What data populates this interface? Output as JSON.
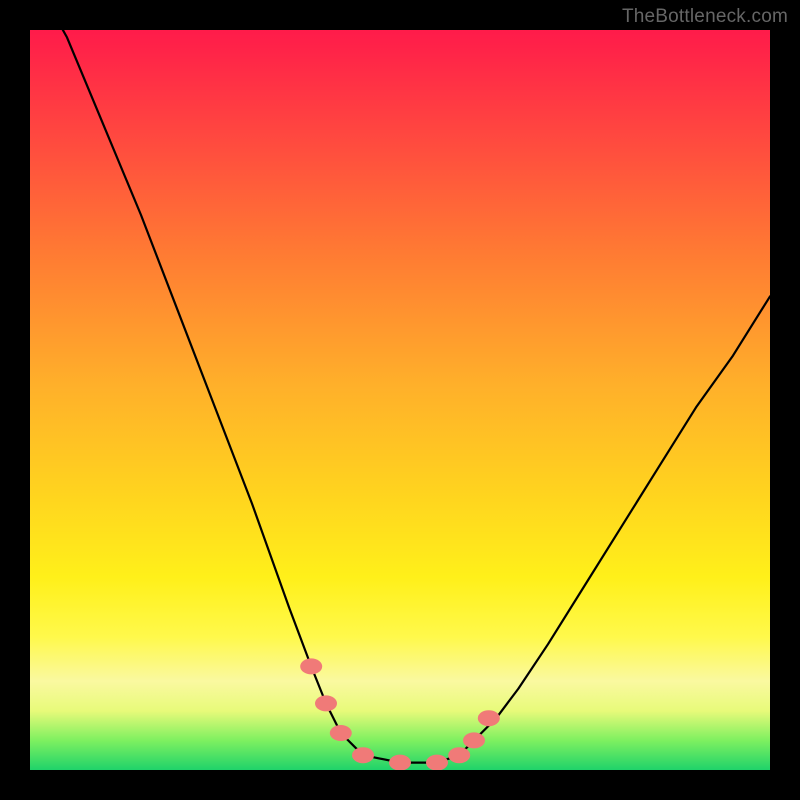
{
  "watermark": "TheBottleneck.com",
  "chart_data": {
    "type": "line",
    "title": "",
    "xlabel": "",
    "ylabel": "",
    "xlim": [
      0,
      100
    ],
    "ylim": [
      0,
      100
    ],
    "series": [
      {
        "name": "curve",
        "x": [
          0,
          5,
          10,
          15,
          20,
          25,
          30,
          35,
          38,
          40,
          42,
          45,
          50,
          55,
          58,
          60,
          63,
          66,
          70,
          75,
          80,
          85,
          90,
          95,
          100
        ],
        "values": [
          108,
          99,
          87,
          75,
          62,
          49,
          36,
          22,
          14,
          9,
          5,
          2,
          1,
          1,
          2,
          4,
          7,
          11,
          17,
          25,
          33,
          41,
          49,
          56,
          64
        ]
      }
    ],
    "markers": {
      "name": "highlight-dots",
      "color": "#f07a78",
      "x": [
        38,
        40,
        42,
        45,
        50,
        55,
        58,
        60,
        62
      ],
      "values": [
        14,
        9,
        5,
        2,
        1,
        1,
        2,
        4,
        7
      ]
    }
  }
}
